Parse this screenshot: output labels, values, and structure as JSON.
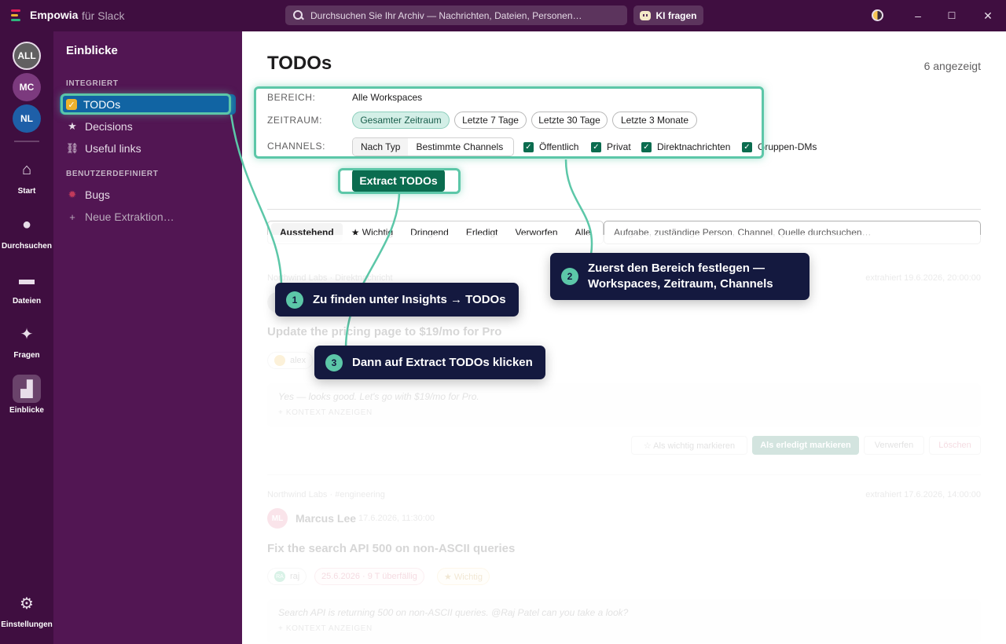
{
  "titlebar": {
    "app_name": "Empowia",
    "app_sub": "für Slack",
    "search_placeholder": "Durchsuchen Sie Ihr Archiv — Nachrichten, Dateien, Personen…",
    "ask_ai": "KI fragen",
    "minimize": "–",
    "maximize": "☐",
    "close": "✕",
    "logo_colors": [
      "#e01e5a",
      "#ecb22e",
      "#2eb67d"
    ]
  },
  "workspaces": [
    {
      "label": "ALL",
      "color": "#616061"
    },
    {
      "label": "MC",
      "color": "#7c3a7e"
    },
    {
      "label": "NL",
      "color": "#1e5fa8"
    }
  ],
  "rail": {
    "start": "Start",
    "search": "Durchsuchen",
    "files": "Dateien",
    "ask": "Fragen",
    "insights": "Einblicke",
    "settings": "Einstellungen"
  },
  "sidebar": {
    "title": "Einblicke",
    "section_integrated": "INTEGRIERT",
    "section_custom": "BENUTZERDEFINIERT",
    "items": [
      {
        "label": "TODOs",
        "icon": "checkbox-icon"
      },
      {
        "label": "Decisions",
        "icon": "star-icon"
      },
      {
        "label": "Useful links",
        "icon": "link-icon"
      }
    ],
    "custom_items": [
      {
        "label": "Bugs",
        "icon": "bug-icon"
      }
    ],
    "add_label": "Neue Extraktion…"
  },
  "main": {
    "title": "TODOs",
    "shown_count": "6 angezeigt",
    "filters": {
      "scope_label": "BEREICH:",
      "scope_value": "Alle Workspaces",
      "range_label": "ZEITRAUM:",
      "ranges": [
        "Gesamter Zeitraum",
        "Letzte 7 Tage",
        "Letzte 30 Tage",
        "Letzte 3 Monate"
      ],
      "channels_label": "CHANNELS:",
      "channel_modes": [
        "Nach Typ",
        "Bestimmte Channels"
      ],
      "channel_types": [
        "Öffentlich",
        "Privat",
        "Direktnachrichten",
        "Gruppen-DMs"
      ]
    },
    "extract_button": "Extract TODOs",
    "tabs": [
      "Ausstehend",
      "★ Wichtig",
      "Dringend",
      "Erledigt",
      "Verworfen",
      "Alle"
    ],
    "filter_placeholder": "Aufgabe, zuständige Person, Channel, Quelle durchsuchen…",
    "cards": [
      {
        "source": "Northwind Labs · Direktnachricht",
        "extracted": "extrahiert 19.6.2026, 20:00:00",
        "title": "Update the pricing page to $19/mo for Pro",
        "assignee": "alex",
        "quote": "Yes — looks good. Let's go with $19/mo for Pro.",
        "context": "+ KONTEXT ANZEIGEN",
        "actions": [
          "☆ Als wichtig markieren",
          "Als erledigt markieren",
          "Verwerfen",
          "Löschen"
        ]
      },
      {
        "source": "Northwind Labs · #engineering",
        "extracted": "extrahiert 17.6.2026, 14:00:00",
        "author": "Marcus Lee",
        "author_initials": "ML",
        "author_time": "17.6.2026, 11:30:00",
        "title": "Fix the search API 500 on non-ASCII queries",
        "assignee": "raj",
        "assignee_initials": "RA",
        "due": "25.6.2026 · 9 T überfällig",
        "important": "★ Wichtig",
        "quote": "Search API is returning 500 on non-ASCII queries. @Raj Patel can you take a look?",
        "context": "+ KONTEXT ANZEIGEN"
      }
    ]
  },
  "callouts": [
    {
      "num": "1",
      "text": "Zu finden unter Insights → TODOs"
    },
    {
      "num": "2",
      "line1": "Zuerst den Bereich festlegen —",
      "line2": "Workspaces, Zeitraum, Channels"
    },
    {
      "num": "3",
      "text": "Dann auf Extract TODOs klicken"
    }
  ],
  "colors": {
    "rail_bg": "#3f0e40",
    "sidebar_bg": "#521653",
    "active_item": "#1164a3",
    "accent_green": "#0b6c4f",
    "highlight": "#5cc7a8",
    "callout_bg": "#14193f"
  }
}
